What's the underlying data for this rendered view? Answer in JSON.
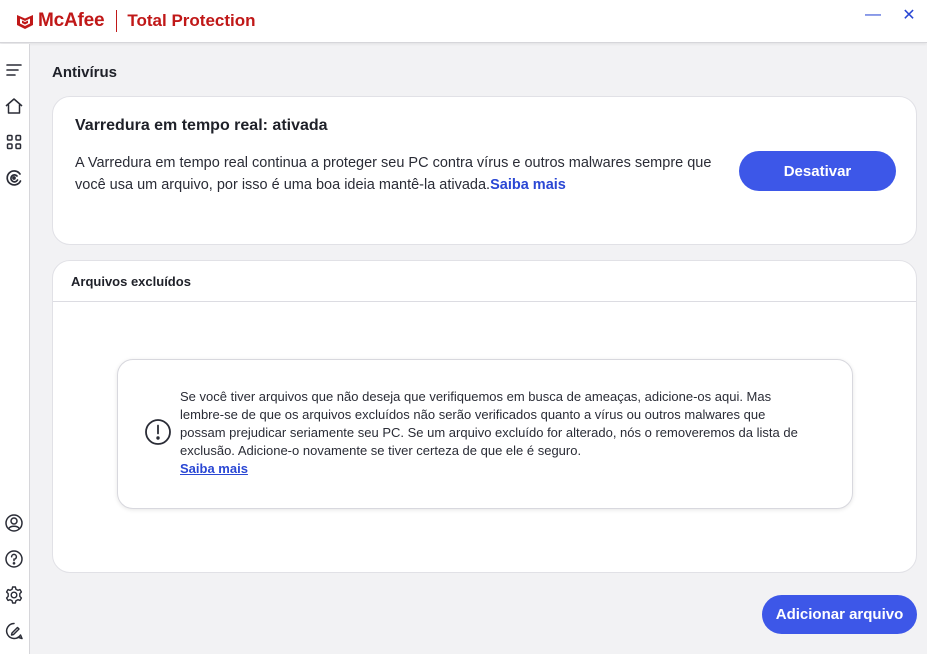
{
  "app": {
    "brand": "McAfee",
    "product": "Total Protection"
  },
  "window_controls": {
    "minimize": "—",
    "close": "✕"
  },
  "sidebar": {
    "items": [
      {
        "icon": "menu-icon"
      },
      {
        "icon": "home-icon"
      },
      {
        "icon": "apps-grid-icon"
      },
      {
        "icon": "protection-icon"
      },
      {
        "icon": "account-icon"
      },
      {
        "icon": "help-icon"
      },
      {
        "icon": "settings-icon"
      },
      {
        "icon": "feedback-icon"
      }
    ]
  },
  "page": {
    "title": "Antivírus"
  },
  "realtime": {
    "title": "Varredura em tempo real: ativada",
    "description": "A Varredura em tempo real continua a proteger seu PC contra vírus e outros malwares sempre que você usa um arquivo, por isso é uma boa ideia mantê-la ativada.",
    "learn_more": "Saiba mais",
    "button": "Desativar"
  },
  "excluded": {
    "header": "Arquivos excluídos",
    "info_text": "Se você tiver arquivos que não deseja que verifiquemos em busca de ameaças, adicione-os aqui. Mas lembre-se de que os arquivos excluídos não serão verificados quanto a vírus ou outros malwares que possam prejudicar seriamente seu PC. Se um arquivo excluído for alterado, nós o removeremos da lista de exclusão. Adicione-o novamente se tiver certeza de que ele é seguro.",
    "learn_more": "Saiba mais"
  },
  "actions": {
    "add_file": "Adicionar arquivo"
  },
  "colors": {
    "brand_red": "#c01818",
    "accent_blue": "#3d57e8",
    "link_blue": "#2a47d4"
  }
}
